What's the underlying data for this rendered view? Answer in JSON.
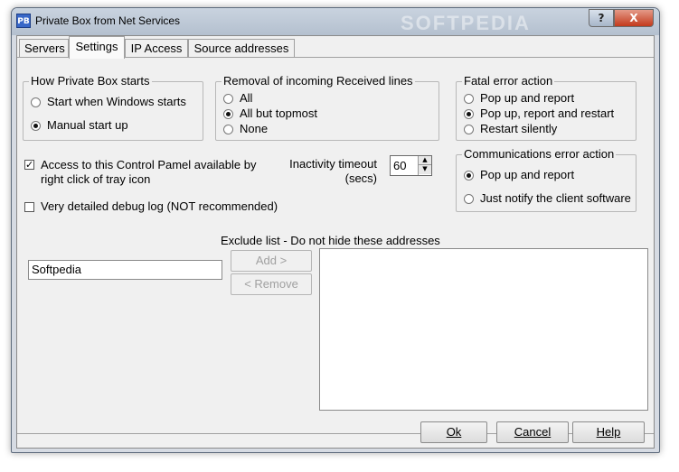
{
  "window": {
    "title": "Private Box from Net Services",
    "app_icon_text": "PB",
    "watermark": "SOFTPEDIA",
    "help_button": "?",
    "close_button": "X"
  },
  "tabs": [
    {
      "label": "Servers",
      "active": false
    },
    {
      "label": "Settings",
      "active": true
    },
    {
      "label": "IP Access",
      "active": false
    },
    {
      "label": "Source addresses",
      "active": false
    }
  ],
  "startup": {
    "legend": "How Private Box starts",
    "options": [
      {
        "label": "Start when Windows starts",
        "selected": false
      },
      {
        "label": "Manual start up",
        "selected": true
      }
    ]
  },
  "removal": {
    "legend": "Removal of incoming Received lines",
    "options": [
      {
        "label": "All",
        "selected": false
      },
      {
        "label": "All but topmost",
        "selected": true
      },
      {
        "label": "None",
        "selected": false
      }
    ]
  },
  "fatal": {
    "legend": "Fatal error action",
    "options": [
      {
        "label": "Pop up and report",
        "selected": false
      },
      {
        "label": "Pop up, report and restart",
        "selected": true
      },
      {
        "label": "Restart silently",
        "selected": false
      }
    ]
  },
  "comms": {
    "legend": "Communications error action",
    "options": [
      {
        "label": "Pop up and report",
        "selected": true
      },
      {
        "label": "Just notify the client software",
        "selected": false
      }
    ]
  },
  "access_checkbox": {
    "line1": "Access to this Control Pamel available by",
    "line2": "right click of tray icon",
    "checked": true
  },
  "debug_checkbox": {
    "label": "Very detailed debug log (NOT recommended)",
    "checked": false
  },
  "inactivity": {
    "line1": "Inactivity timeout",
    "line2": "(secs)",
    "value": "60"
  },
  "exclude": {
    "heading": "Exclude list - Do not hide these addresses",
    "input_value": "Softpedia",
    "add_label": "Add >",
    "remove_label": "< Remove"
  },
  "footer": {
    "ok": "Ok",
    "cancel": "Cancel",
    "help": "Help"
  }
}
